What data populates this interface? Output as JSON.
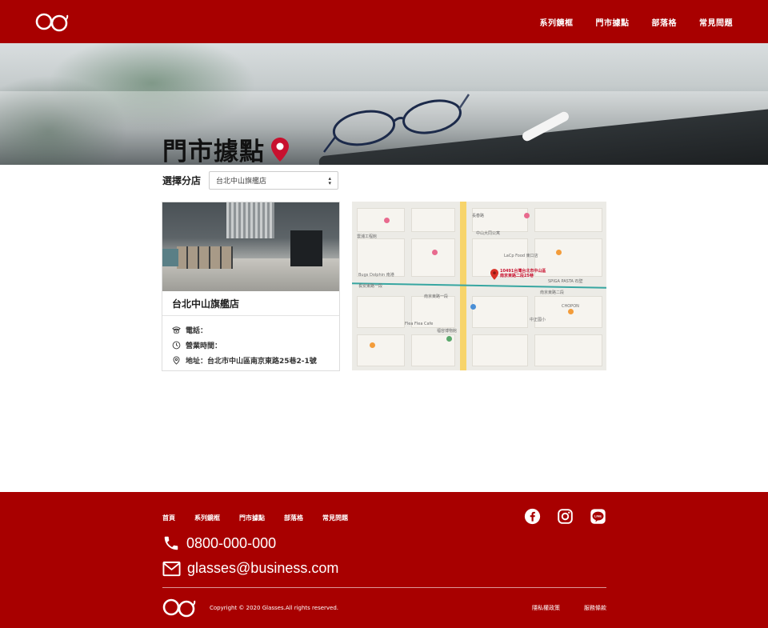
{
  "header": {
    "nav": [
      {
        "label": "系列鏡框"
      },
      {
        "label": "門市據點"
      },
      {
        "label": "部落格"
      },
      {
        "label": "常見問題"
      }
    ]
  },
  "hero": {
    "title": "門市據點"
  },
  "selector": {
    "label": "選擇分店",
    "selected": "台北中山旗艦店"
  },
  "store": {
    "name": "台北中山旗艦店",
    "phone_label": "電話：",
    "hours_label": "營業時間：",
    "address_label": "地址：台北市中山區南京東路25巷2-1號"
  },
  "map": {
    "pin_label": "10491台灣台北市中山區南京東路二段25巷",
    "labels": [
      "長春路",
      "中山大同公寓",
      "LaCp Food 東口店",
      "南京東路二段",
      "SPIGA PASTA 石壁",
      "CHOPON",
      "中正國小",
      "福容博物館",
      "Flea Flea Cafe",
      "Bugs Dolphin 南港",
      "雲浦工程館",
      "南京東路一段",
      "長安東路一段"
    ]
  },
  "footer": {
    "nav": [
      {
        "label": "首頁"
      },
      {
        "label": "系列鏡框"
      },
      {
        "label": "門市據點"
      },
      {
        "label": "部落格"
      },
      {
        "label": "常見問題"
      }
    ],
    "phone": "0800-000-000",
    "email": "glasses@business.com",
    "copyright": "Copyright © 2020 Glasses.All rights reserved.",
    "links": [
      {
        "label": "隱私權政策"
      },
      {
        "label": "服務條款"
      }
    ]
  },
  "colors": {
    "brand": "#a80000",
    "pin": "#c8102e"
  }
}
